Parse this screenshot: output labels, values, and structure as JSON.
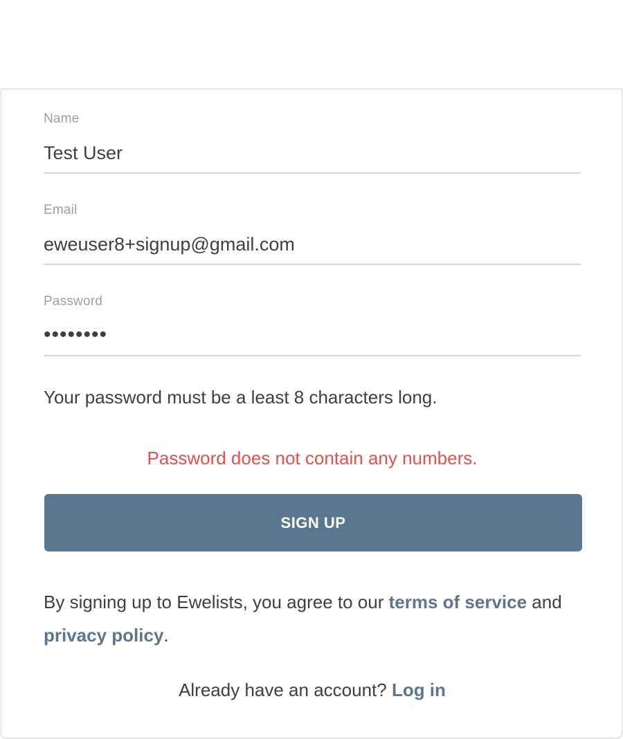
{
  "form": {
    "name": {
      "label": "Name",
      "value": "Test User"
    },
    "email": {
      "label": "Email",
      "value": "eweuser8+signup@gmail.com"
    },
    "password": {
      "label": "Password",
      "value": "••••••••"
    },
    "password_hint": "Your password must be a least 8 characters long.",
    "error_message": "Password does not contain any numbers.",
    "submit_label": "SIGN UP"
  },
  "agreement": {
    "prefix": "By signing up to Ewelists, you agree to our ",
    "terms_link": "terms of service",
    "middle": " and",
    "privacy_link": "privacy policy",
    "suffix": "."
  },
  "login": {
    "prompt": "Already have an account? ",
    "link": "Log in"
  },
  "colors": {
    "accent": "#5a778f",
    "error": "#e4504a",
    "text": "#3c4043",
    "label": "#9e9e9e"
  }
}
